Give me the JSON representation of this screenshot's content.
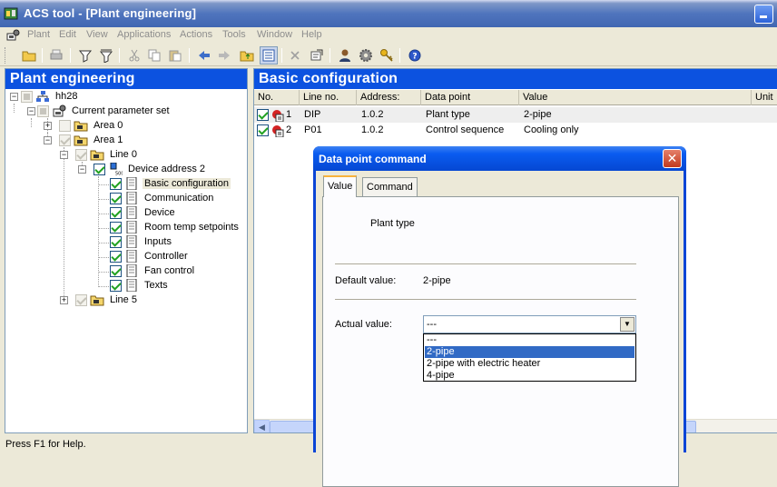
{
  "window": {
    "title": "ACS tool - [Plant engineering]"
  },
  "menu": [
    "Plant",
    "Edit",
    "View",
    "Applications",
    "Actions",
    "Tools",
    "Window",
    "Help"
  ],
  "toolbar": {
    "buttons": [
      "open-folder",
      "print",
      "filter-a",
      "filter-b",
      "cut",
      "copy",
      "paste",
      "arrow-left",
      "arrow-right",
      "folder-up",
      "list-view",
      "delete",
      "properties",
      "user",
      "gear",
      "key",
      "help"
    ]
  },
  "left_panel": {
    "title": "Plant engineering",
    "tree": [
      {
        "label": "hh28"
      },
      {
        "label": "Current parameter set"
      },
      {
        "label": "Area 0"
      },
      {
        "label": "Area 1"
      },
      {
        "label": "Line 0"
      },
      {
        "label": "Device address 2"
      },
      {
        "label": "Basic configuration"
      },
      {
        "label": "Communication"
      },
      {
        "label": "Device"
      },
      {
        "label": "Room temp setpoints"
      },
      {
        "label": "Inputs"
      },
      {
        "label": "Controller"
      },
      {
        "label": "Fan control"
      },
      {
        "label": "Texts"
      },
      {
        "label": "Line 5"
      }
    ]
  },
  "right_panel": {
    "title": "Basic configuration",
    "columns": [
      "No.",
      "Line no.",
      "Address:",
      "Data point",
      "Value",
      "Unit"
    ],
    "rows": [
      {
        "no": "1",
        "line": "DIP",
        "address": "1.0.2",
        "data_point": "Plant type",
        "value": "2-pipe"
      },
      {
        "no": "2",
        "line": "P01",
        "address": "1.0.2",
        "data_point": "Control sequence",
        "value": "Cooling only"
      }
    ]
  },
  "dialog": {
    "title": "Data point command",
    "tabs": [
      "Value",
      "Command"
    ],
    "data_point_name": "Plant type",
    "default_label": "Default value:",
    "default_value": "2-pipe",
    "actual_label": "Actual value:",
    "actual_value": "---",
    "options": [
      "---",
      "2-pipe",
      "2-pipe with electric heater",
      "4-pipe"
    ],
    "highlighted_option": "2-pipe"
  },
  "status": {
    "text": "Press F1 for Help."
  }
}
